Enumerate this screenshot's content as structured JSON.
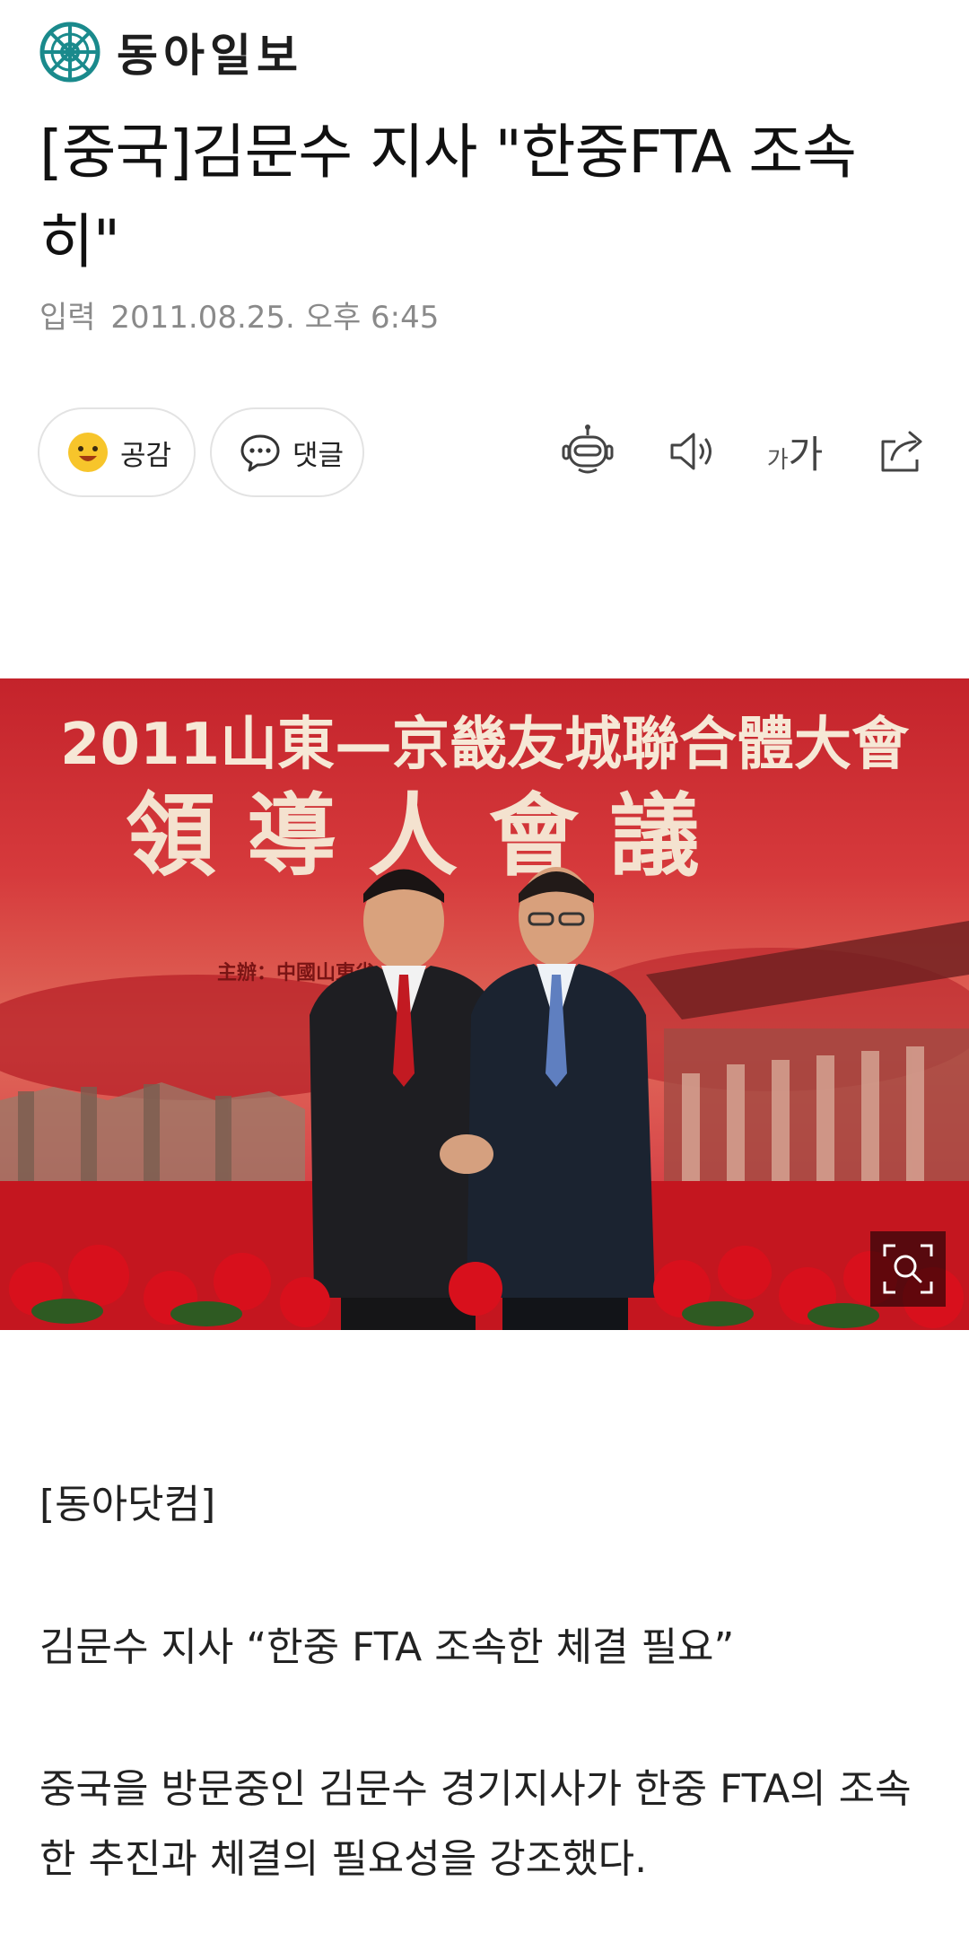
{
  "header": {
    "logo_text": "동아일보",
    "logo_icon": "dongailbo-emblem-icon",
    "brand_color": "#1a8a8c"
  },
  "article": {
    "title": "[중국]김문수 지사 \"한중FTA 조속히\"",
    "date_label": "입력",
    "date_value": "2011.08.25. 오후 6:45"
  },
  "actions": {
    "like_label": "공감",
    "like_icon": "smiley-face-icon",
    "comment_label": "댓글",
    "comment_icon": "speech-bubble-icon",
    "tools": [
      {
        "name": "ai-summary-bot",
        "icon": "robot-icon"
      },
      {
        "name": "text-to-speech",
        "icon": "speaker-icon"
      },
      {
        "name": "font-size",
        "icon": "font-size-icon",
        "small": "가",
        "big": "가"
      },
      {
        "name": "share",
        "icon": "share-icon"
      }
    ]
  },
  "photo": {
    "banner_line1": "2011山東—京畿友城聯合體大會",
    "banner_line2": "領 導 人 會 議",
    "banner_small": "主辦：中國山東省",
    "zoom_icon": "zoom-search-icon"
  },
  "body": {
    "source": "[동아닷컴]",
    "para1": "김문수 지사 “한중 FTA 조속한 체결 필요”",
    "para2": "중국을 방문중인 김문수 경기지사가 한중 FTA의 조속한 추진과 체결의 필요성을 강조했다."
  }
}
